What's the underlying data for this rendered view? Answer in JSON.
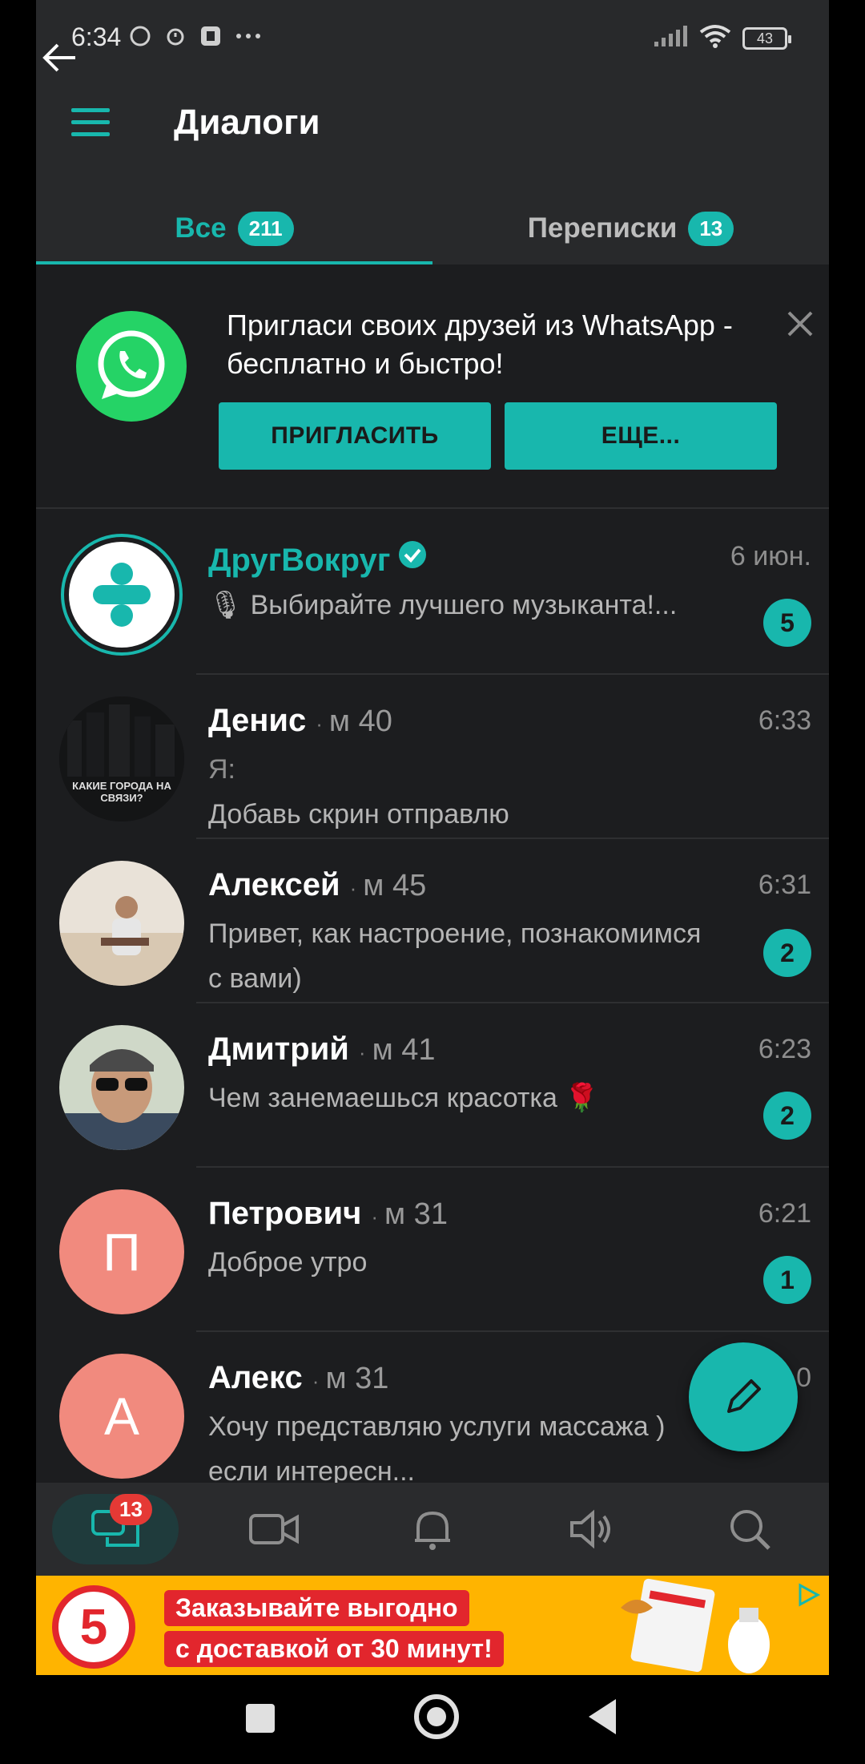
{
  "status": {
    "time": "6:34",
    "battery": "43"
  },
  "header": {
    "title": "Диалоги"
  },
  "tabs": [
    {
      "label": "Все",
      "count": "211"
    },
    {
      "label": "Переписки",
      "count": "13"
    }
  ],
  "invite": {
    "text": "Пригласи своих друзей из WhatsApp - бесплатно и быстро!",
    "invite_label": "ПРИГЛАСИТЬ",
    "more_label": "ЕЩЕ..."
  },
  "chats": [
    {
      "name": "ДругВокруг",
      "meta": "",
      "time": "6 июн.",
      "message": "🎙 Выбирайте лучшего музыканта!...",
      "unread": "5"
    },
    {
      "name": "Денис",
      "meta": "м 40",
      "time": "6:33",
      "message_line1": "Я:",
      "message_line2": "Добавь скрин отправлю",
      "avatar_caption": "КАКИЕ ГОРОДА НА СВЯЗИ?"
    },
    {
      "name": "Алексей",
      "meta": "м 45",
      "time": "6:31",
      "message": "Привет, как настроение, познакомимся с вами)",
      "unread": "2"
    },
    {
      "name": "Дмитрий",
      "meta": "м 41",
      "time": "6:23",
      "message": "Чем занемаешься красотка 🌹",
      "unread": "2"
    },
    {
      "name": "Петрович",
      "meta": "м 31",
      "time": "6:21",
      "message": "Доброе утро",
      "unread": "1",
      "avatar_letter": "П"
    },
    {
      "name": "Алекс",
      "meta": "м 31",
      "time": "0",
      "message": "Хочу представляю услуги массажа ) если интересн...",
      "avatar_letter": "А"
    }
  ],
  "bottom_nav": {
    "messages_badge": "13"
  },
  "ad": {
    "logo": "5",
    "line1": "Заказывайте выгодно",
    "line2": "с доставкой от 30 минут!"
  },
  "colors": {
    "accent": "#18b7ad",
    "background": "#1c1d1f",
    "topbar": "#28292b"
  }
}
